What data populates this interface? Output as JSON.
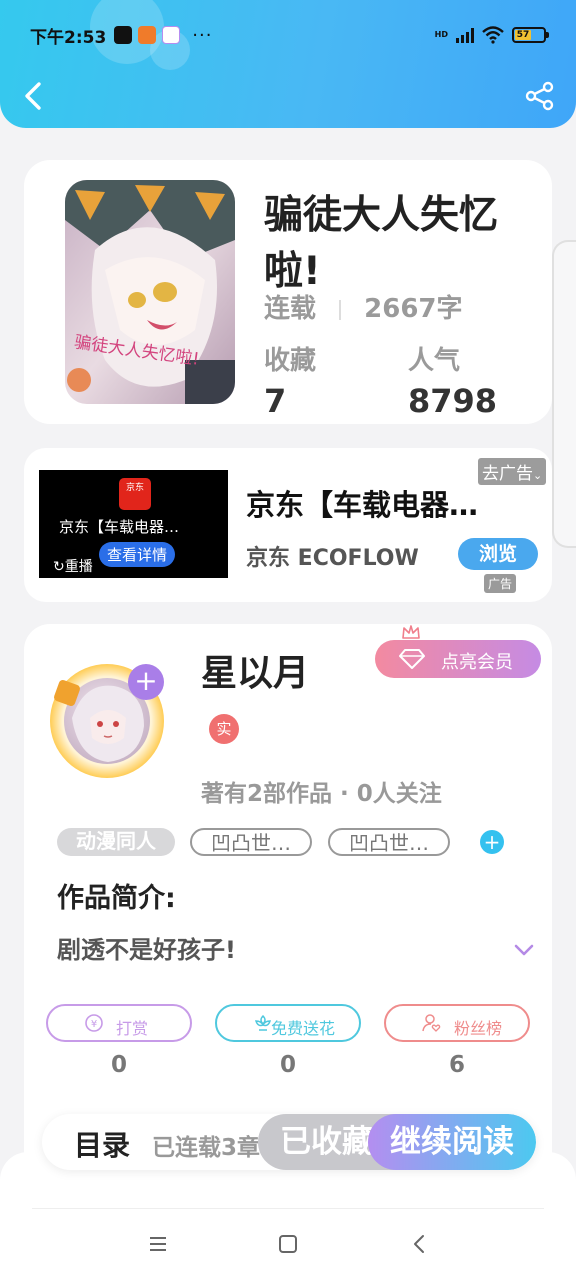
{
  "status_bar": {
    "time": "下午2:53",
    "network": "HD",
    "battery": "57",
    "more": "···"
  },
  "book": {
    "title": "骗徒大人失忆啦!",
    "status": "连载",
    "word_count": "2667字",
    "collect_label": "收藏",
    "collect_value": "7",
    "popularity_label": "人气",
    "popularity_value": "8798",
    "cover_caption": "骗徒大人失忆啦!"
  },
  "ad": {
    "video_title": "京东【车载电器…",
    "video_logo": "京东",
    "video_detail": "查看详情",
    "video_replay": "重播",
    "title": "京东【车载电器…",
    "brand": "京东 ECOFLOW",
    "browse": "浏览",
    "remove": "去广告",
    "badge": "广告"
  },
  "author": {
    "name": "星以月",
    "vip_button": "点亮会员",
    "real_badge": "实",
    "meta": "著有2部作品 · 0人关注",
    "tags": [
      "动漫同人",
      "凹凸世…",
      "凹凸世…"
    ],
    "intro_label": "作品简介:",
    "intro_text": "剧透不是好孩子!",
    "actions": [
      {
        "label": "打赏",
        "count": "0",
        "color": "#c79be8"
      },
      {
        "label": "免费送花",
        "count": "0",
        "color": "#4fc8de"
      },
      {
        "label": "粉丝榜",
        "count": "6",
        "color": "#ef8c8c"
      }
    ]
  },
  "bottom_bar": {
    "toc": "目录",
    "toc_status": "已连载3章",
    "favorited": "已收藏",
    "continue_reading": "继续阅读"
  },
  "colors": {
    "header_gradient_start": "#35c9ee",
    "header_gradient_end": "#3fa6f8",
    "accent_blue": "#4aa8ee",
    "vip_pink": "#f38aa0",
    "vip_purple": "#c58be4"
  }
}
